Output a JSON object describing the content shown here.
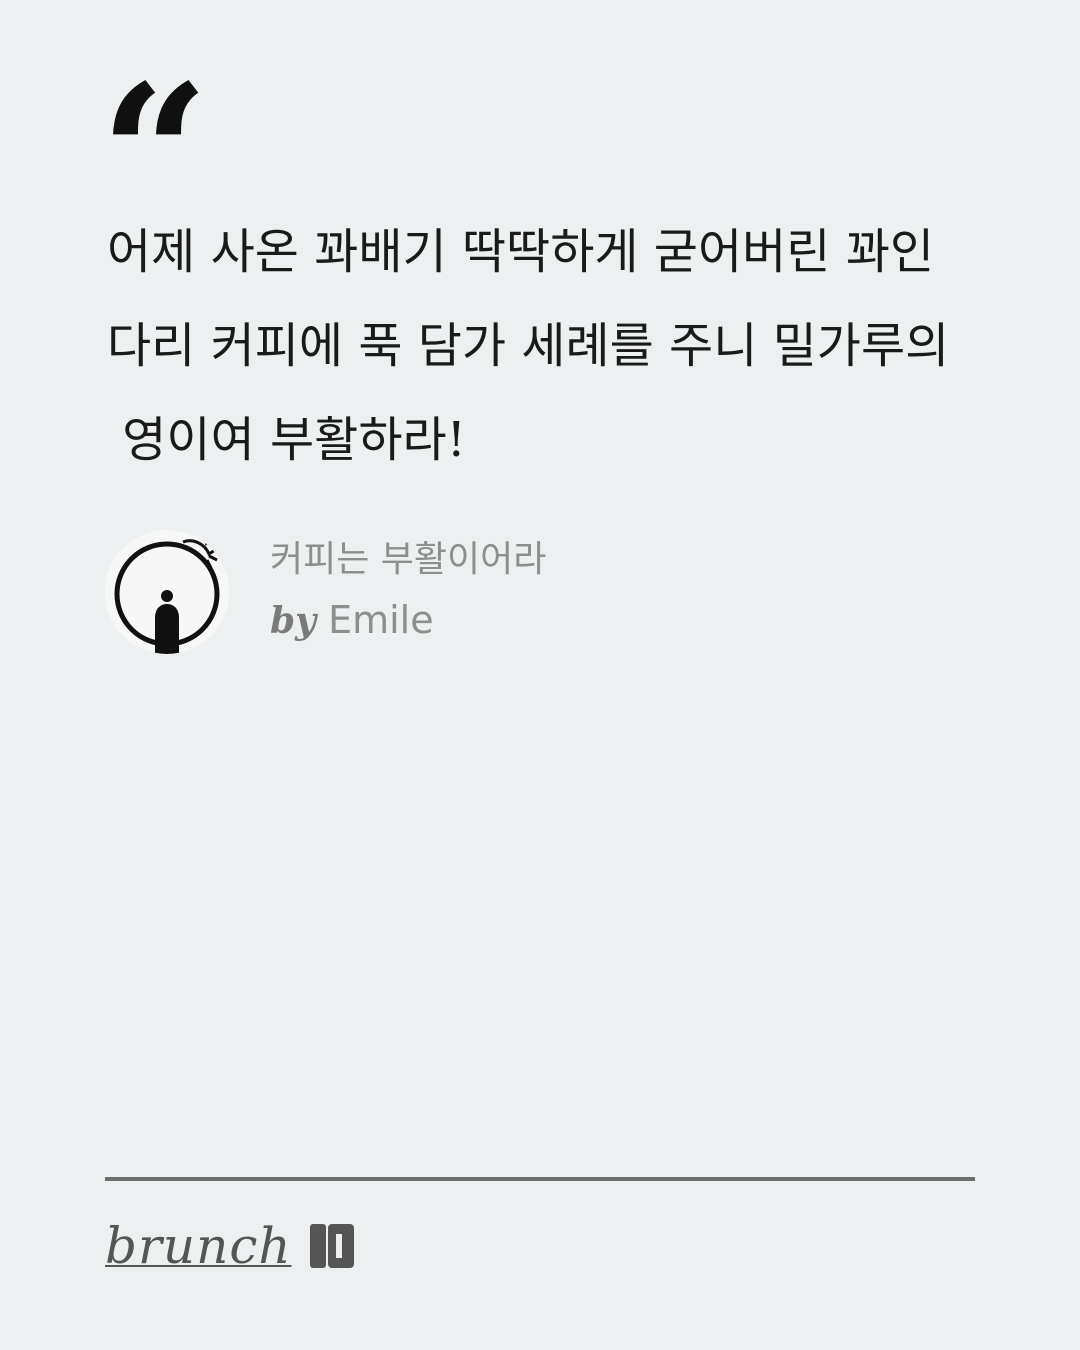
{
  "quote": {
    "mark": "“",
    "lines": [
      "어제 사온 꽈배기 딱딱하게 굳어버린 꽈인",
      "다리 커피에 푹 담가 세례를 주니 밀가루의",
      " 영이여 부활하라!"
    ]
  },
  "author": {
    "book_title": "커피는 부활이어라",
    "by_label": "by",
    "name": "Emile",
    "avatar_icon": "avatar-silhouette-ring"
  },
  "footer": {
    "brand": "brunch",
    "brand_icon": "brunch-book-icon",
    "divider_color": "#6e6e6e"
  },
  "colors": {
    "background": "#ecf0f1",
    "text": "#1a1a1a",
    "muted": "#8e8e8e"
  }
}
